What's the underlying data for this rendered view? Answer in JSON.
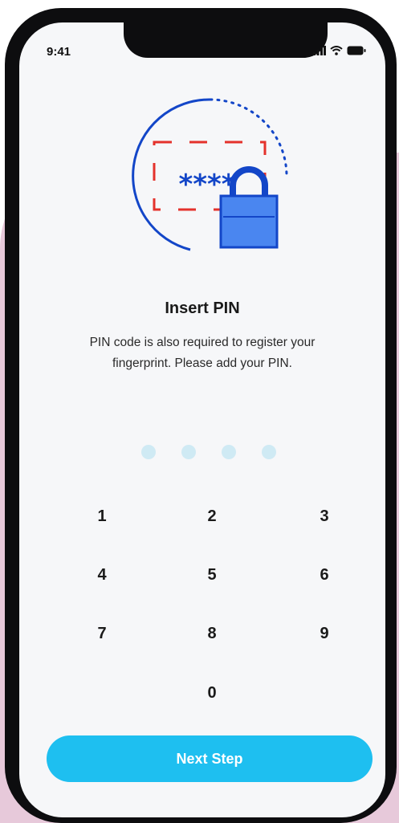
{
  "status_bar": {
    "time": "9:41",
    "icons": [
      "signal-icon",
      "wifi-icon",
      "battery-icon"
    ]
  },
  "illustration": {
    "text": "****",
    "icon": "lock-icon"
  },
  "title": "Insert PIN",
  "subtitle": "PIN code is also required to register your fingerprint. Please add your PIN.",
  "pin": {
    "length": 4,
    "filled": 0
  },
  "keypad": {
    "keys": [
      "1",
      "2",
      "3",
      "4",
      "5",
      "6",
      "7",
      "8",
      "9",
      "0"
    ]
  },
  "next_button": {
    "label": "Next Step"
  },
  "colors": {
    "accent": "#1ebff0",
    "pin_dot": "#cfeaf4",
    "illustration_blue": "#1346c8",
    "illustration_red": "#e4322c",
    "background_blob": "#e7c9da"
  }
}
